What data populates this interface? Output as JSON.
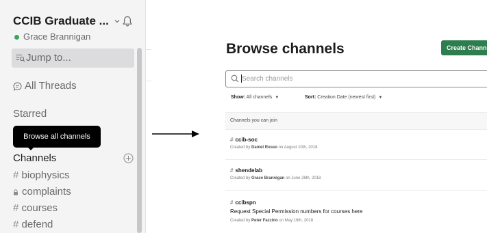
{
  "sidebar": {
    "workspace_name": "CCIB Graduate ...",
    "user_name": "Grace Brannigan",
    "jump_to": "Jump to...",
    "all_threads": "All Threads",
    "starred_label": "Starred",
    "tooltip": "Browse all channels",
    "channels_label": "Channels",
    "channels": [
      {
        "prefix": "#",
        "name": "biophysics",
        "private": false
      },
      {
        "prefix": "",
        "name": "complaints",
        "private": true
      },
      {
        "prefix": "#",
        "name": "courses",
        "private": false
      },
      {
        "prefix": "#",
        "name": "defend",
        "private": false
      }
    ],
    "presence_color": "#3ba55c"
  },
  "browse": {
    "title": "Browse channels",
    "create_button": "Create Channel",
    "search_placeholder": "Search channels",
    "show_label": "Show:",
    "show_value": "All channels",
    "sort_label": "Sort:",
    "sort_value": "Creation Date (newest first)",
    "section_header": "Channels you can join",
    "channels": [
      {
        "name": "ccib-soc",
        "purpose": "",
        "created_prefix": "Created by",
        "creator": "Daniel Russo",
        "created_suffix": "on August 10th, 2018"
      },
      {
        "name": "shendelab",
        "purpose": "",
        "created_prefix": "Created by",
        "creator": "Grace Brannigan",
        "created_suffix": "on June 26th, 2018"
      },
      {
        "name": "ccibspn",
        "purpose": "Request Special Permission numbers for courses here",
        "created_prefix": "Created by",
        "creator": "Peter Fazzino",
        "created_suffix": "on May 16th, 2018"
      }
    ],
    "accent_color": "#2e7d4f"
  }
}
